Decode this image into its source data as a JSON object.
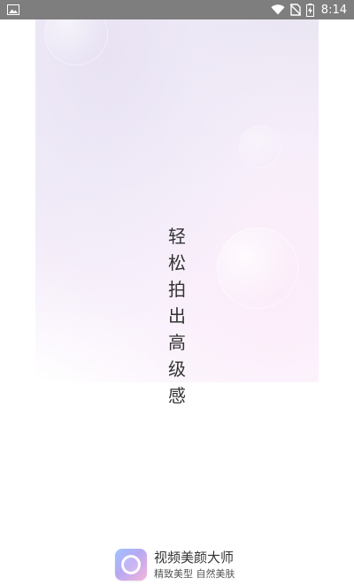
{
  "status_bar": {
    "time": "8:14",
    "icons": [
      "image-icon",
      "wifi-icon",
      "no-sim-icon",
      "battery-charging-icon"
    ]
  },
  "splash": {
    "slogan_chars": [
      "轻",
      "松",
      "拍",
      "出",
      "高",
      "级",
      "感"
    ]
  },
  "brand": {
    "app_name": "视频美颜大师",
    "tagline": "精致美型 自然美肤",
    "icon": "camera-lens-icon"
  },
  "colors": {
    "status_bar_bg": "#7e7e7e",
    "text_primary": "#333333"
  }
}
